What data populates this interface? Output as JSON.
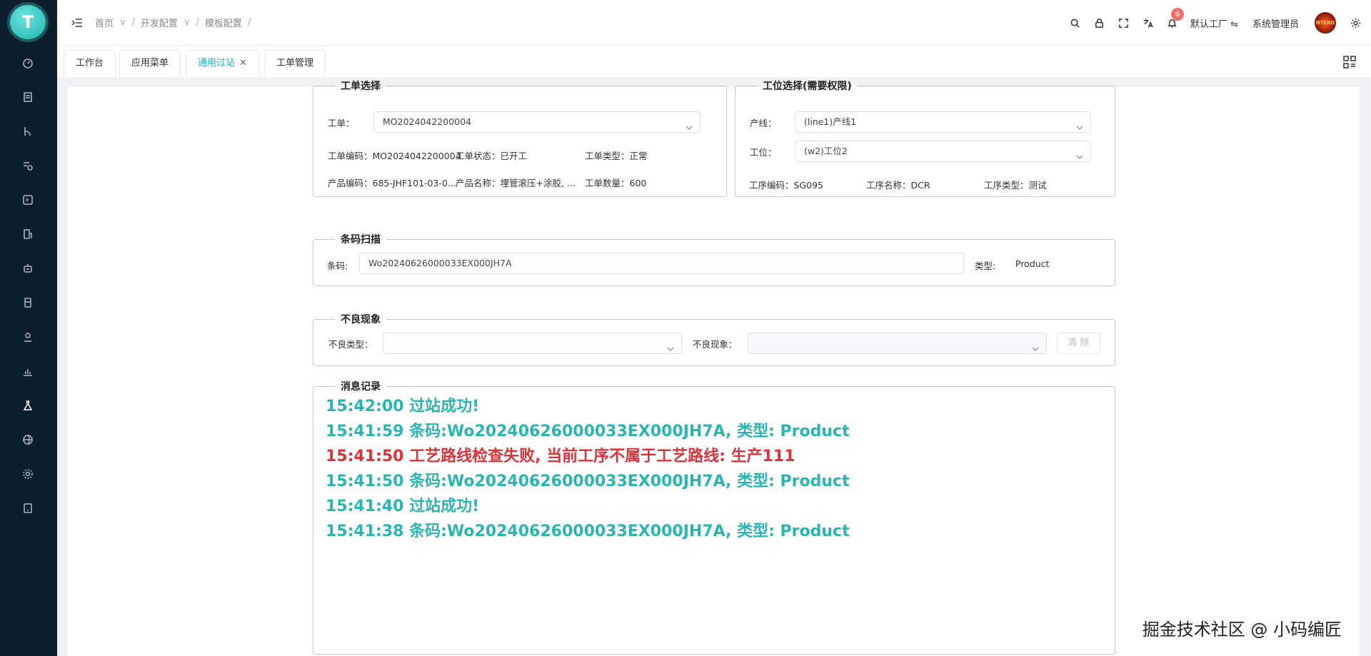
{
  "logo": {
    "letter": "T"
  },
  "header": {
    "breadcrumb": [
      "首页",
      "开发配置",
      "模板配置"
    ],
    "notification_count": "6",
    "factory": "默认工厂 ⇋",
    "user": "系统管理员",
    "avatar_text": "NTEKO"
  },
  "tabs": [
    {
      "label": "工作台"
    },
    {
      "label": "应用菜单"
    },
    {
      "label": "通用过站"
    },
    {
      "label": "工单管理"
    }
  ],
  "work_order": {
    "legend": "工单选择",
    "select_label": "工单：",
    "select_value": "MO2024042200004",
    "code_label": "工单编码：",
    "code_value": "MO2024042200004",
    "status_label": "工单状态：",
    "status_value": "已开工",
    "type_label": "工单类型：",
    "type_value": "正常",
    "product_code_label": "产品编码：",
    "product_code_value": "685-JHF101-03-0...",
    "product_name_label": "产品名称：",
    "product_name_value": "埋管滚压+涂胶, ...",
    "qty_label": "工单数量：",
    "qty_value": "600"
  },
  "station": {
    "legend": "工位选择(需要权限)",
    "line_label": "产线：",
    "line_value": "(line1)产线1",
    "station_label": "工位：",
    "station_value": "(w2)工位2",
    "proc_code_label": "工序编码：",
    "proc_code_value": "SG095",
    "proc_name_label": "工序名称：",
    "proc_name_value": "DCR",
    "proc_type_label": "工序类型：",
    "proc_type_value": "测试"
  },
  "barcode": {
    "legend": "条码扫描",
    "label": "条码:",
    "value": "Wo20240626000033EX000JH7A",
    "type_label": "类型:",
    "type_value": "Product"
  },
  "defect": {
    "legend": "不良现象",
    "type_label": "不良类型：",
    "phenomenon_label": "不良现象：",
    "clear": "清 除"
  },
  "messages": {
    "legend": "消息记录",
    "items": [
      {
        "text": "15:42:00 过站成功!",
        "color": "#2ab5b0"
      },
      {
        "text": "15:41:59 条码:Wo20240626000033EX000JH7A, 类型: Product",
        "color": "#2ab5b0"
      },
      {
        "text": "15:41:50 工艺路线检查失败, 当前工序不属于工艺路线: 生产111",
        "color": "#d9343b"
      },
      {
        "text": "15:41:50 条码:Wo20240626000033EX000JH7A, 类型: Product",
        "color": "#2ab5b0"
      },
      {
        "text": "15:41:40 过站成功!",
        "color": "#2ab5b0"
      },
      {
        "text": "15:41:38 条码:Wo20240626000033EX000JH7A, 类型: Product",
        "color": "#2ab5b0"
      }
    ]
  },
  "watermark": "掘金技术社区 @ 小码编匠"
}
